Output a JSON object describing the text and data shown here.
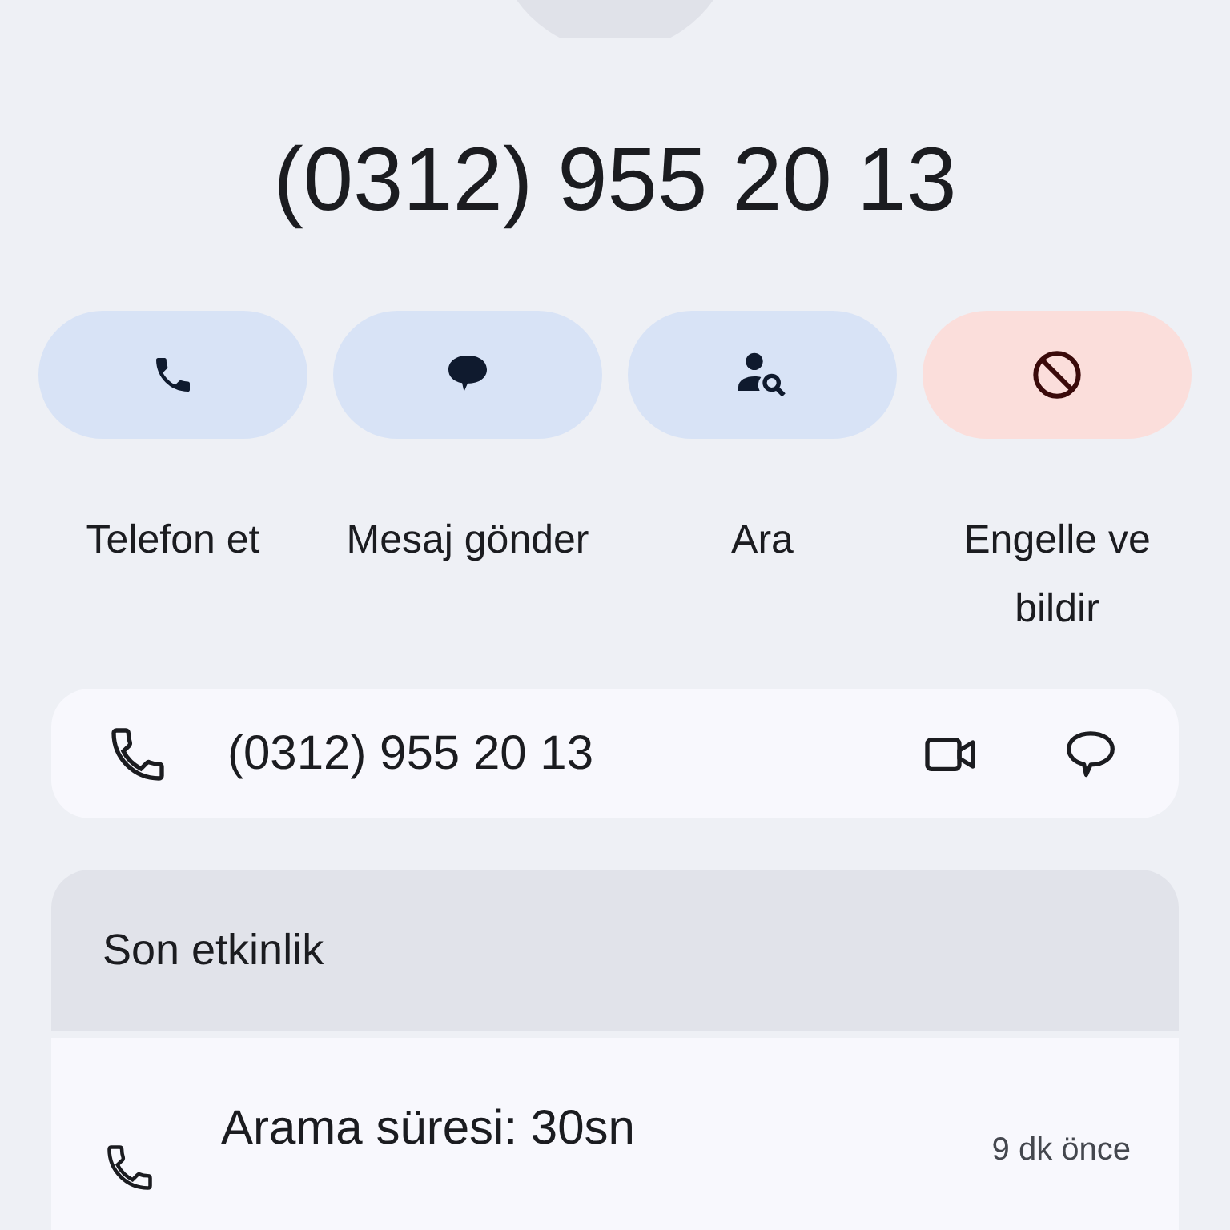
{
  "contact": {
    "title": "(0312) 955 20 13"
  },
  "actions": [
    {
      "kind": "call",
      "label": "Telefon et"
    },
    {
      "kind": "message",
      "label": "Mesaj gönder"
    },
    {
      "kind": "search",
      "label": "Ara"
    },
    {
      "kind": "block",
      "label": "Engelle ve bildir"
    }
  ],
  "number_card": {
    "number": "(0312) 955 20 13"
  },
  "activity": {
    "title": "Son etkinlik",
    "items": [
      {
        "text": "Arama süresi: 30sn",
        "time": "9 dk önce"
      }
    ]
  }
}
